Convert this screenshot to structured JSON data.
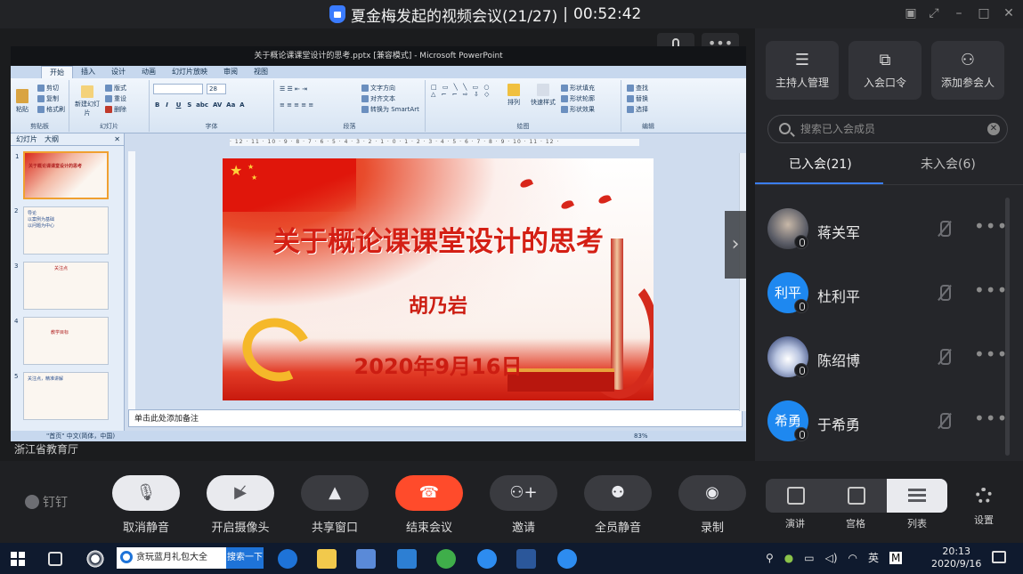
{
  "window": {
    "title": "夏金梅发起的视频会议(21/27)",
    "separator": "|",
    "duration": "00:52:42"
  },
  "stage": {
    "presenter_org": "浙江省教育厅",
    "ppt": {
      "window_title": "关于概论课课堂设计的思考.pptx [兼容模式] - Microsoft PowerPoint",
      "tabs": [
        "开始",
        "插入",
        "设计",
        "动画",
        "幻灯片放映",
        "审阅",
        "视图"
      ],
      "groups": [
        "剪贴板",
        "幻灯片",
        "字体",
        "段落",
        "绘图",
        "编辑"
      ],
      "clipboard": {
        "paste": "粘贴",
        "cut": "剪切",
        "copy": "复制",
        "format": "格式刷"
      },
      "slides_group": {
        "new": "新建幻灯片",
        "layout": "版式",
        "reset": "重设",
        "delete": "删除"
      },
      "font_size": "28",
      "paragraph": {
        "direction": "文字方向",
        "align": "对齐文本",
        "smartart": "转换为 SmartArt"
      },
      "drawing": {
        "arrange": "排列",
        "quick_styles": "快速样式",
        "fill": "形状填充",
        "outline": "形状轮廓",
        "effects": "形状效果"
      },
      "editing": {
        "find": "查找",
        "replace": "替换",
        "select": "选择"
      },
      "left_tabs": [
        "幻灯片",
        "大纲"
      ],
      "thumb_numbers": [
        "1",
        "2",
        "3",
        "4",
        "5"
      ],
      "thumb1_text": "关于概论课课堂设计的思考",
      "thumb2_text": "导论\n以案例为基础\n以问题为中心",
      "thumb3_text": "关注点",
      "thumb4_text": "教学目标",
      "thumb5_text": "关注点，精准讲解",
      "notes_placeholder": "单击此处添加备注",
      "status": "\"首页\"    中文(简体，中国)",
      "zoom": "83%"
    },
    "slide": {
      "title": "关于概论课课堂设计的思考",
      "author": "胡乃岩",
      "date": "2020年9月16日"
    }
  },
  "panel": {
    "tools": [
      {
        "label": "主持人管理",
        "icon": "sliders-icon"
      },
      {
        "label": "入会口令",
        "icon": "share-icon"
      },
      {
        "label": "添加参会人",
        "icon": "add-person-icon"
      }
    ],
    "search_placeholder": "搜索已入会成员",
    "tab_joined": "已入会(21)",
    "tab_not_joined": "未入会(6)",
    "members": [
      {
        "name": "蒋关军",
        "avatar_text": ""
      },
      {
        "name": "杜利平",
        "avatar_text": "利平"
      },
      {
        "name": "陈绍博",
        "avatar_text": ""
      },
      {
        "name": "于希勇",
        "avatar_text": "希勇"
      }
    ]
  },
  "toolbar": {
    "brand": "钉钉",
    "buttons": [
      {
        "label": "取消静音",
        "icon": "mic-muted-icon"
      },
      {
        "label": "开启摄像头",
        "icon": "camera-off-icon"
      },
      {
        "label": "共享窗口",
        "icon": "share-screen-icon"
      },
      {
        "label": "结束会议",
        "icon": "hangup-icon"
      },
      {
        "label": "邀请",
        "icon": "invite-icon"
      },
      {
        "label": "全员静音",
        "icon": "mute-all-icon"
      },
      {
        "label": "录制",
        "icon": "record-icon"
      }
    ],
    "layouts": [
      "演讲",
      "宫格",
      "列表"
    ],
    "settings": "设置"
  },
  "taskbar": {
    "search_text": "贪玩蓝月礼包大全",
    "search_button": "搜索一下",
    "ime": "英",
    "time": "20:13",
    "date": "2020/9/16"
  },
  "colors": {
    "accent": "#3b7ef6",
    "end_call": "#ff4b2b",
    "slide_red": "#d41f14"
  }
}
